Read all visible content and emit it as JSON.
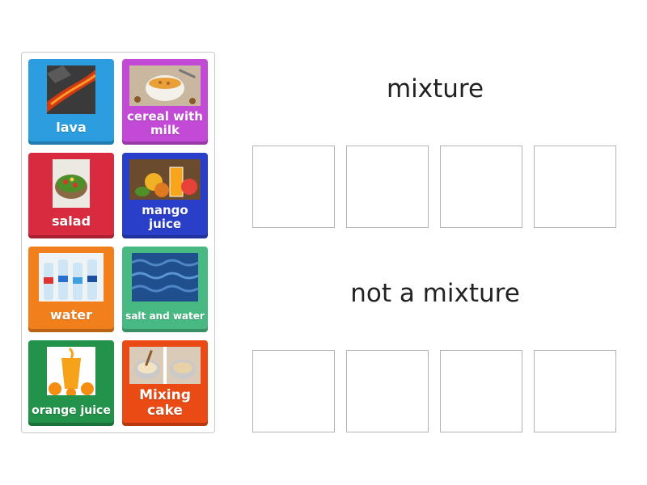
{
  "tiles": [
    {
      "label": "lava",
      "color": "#2c9ee0",
      "image": "lava-photo"
    },
    {
      "label": "cereal with milk",
      "color": "#c24ad6",
      "image": "cereal-bowl-photo"
    },
    {
      "label": "salad",
      "color": "#d92b3f",
      "image": "salad-bowl-photo"
    },
    {
      "label": "mango juice",
      "color": "#2a3fc9",
      "image": "mango-juice-photo"
    },
    {
      "label": "water",
      "color": "#f07f1c",
      "image": "water-bottles-photo"
    },
    {
      "label": "salt and water",
      "color": "#49b983",
      "image": "ocean-water-photo"
    },
    {
      "label": "orange juice",
      "color": "#23924a",
      "image": "orange-juice-photo"
    },
    {
      "label": "Mixing cake",
      "color": "#ea4a14",
      "image": "mixing-cake-photo"
    }
  ],
  "groups": [
    {
      "title": "mixture"
    },
    {
      "title": "not a mixture"
    }
  ]
}
